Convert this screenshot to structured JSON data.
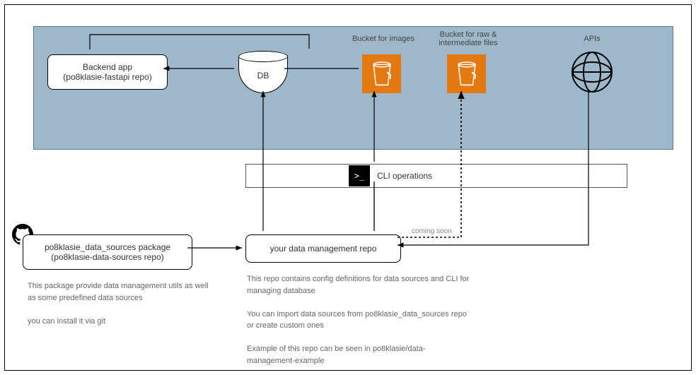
{
  "backend": {
    "title": "Backend app",
    "subtitle": "(po8klasie-fastapi repo)"
  },
  "db": {
    "label": "DB"
  },
  "bucket1": {
    "label": "Bucket for images"
  },
  "bucket2": {
    "label": "Bucket for raw & intermediate files"
  },
  "apis": {
    "label": "APIs"
  },
  "cli": {
    "label": "CLI operations",
    "prompt": ">_"
  },
  "package": {
    "title": "po8klasie_data_sources package",
    "subtitle": "(po8klasie-data-sources repo)"
  },
  "mgmt": {
    "title": "your data management repo"
  },
  "coming": "coming soon",
  "desc1": {
    "p1": "This package provide data management utils as well as some predefined data sources",
    "p2": "you can install it via git"
  },
  "desc2": {
    "p1": "This repo contains config definitions for data sources and CLI for managing database",
    "p2": "You can import data sources from po8klasie_data_sources repo or create custom ones",
    "p3": "Example of this repo can be seen in po8klasie/data-management-example"
  }
}
